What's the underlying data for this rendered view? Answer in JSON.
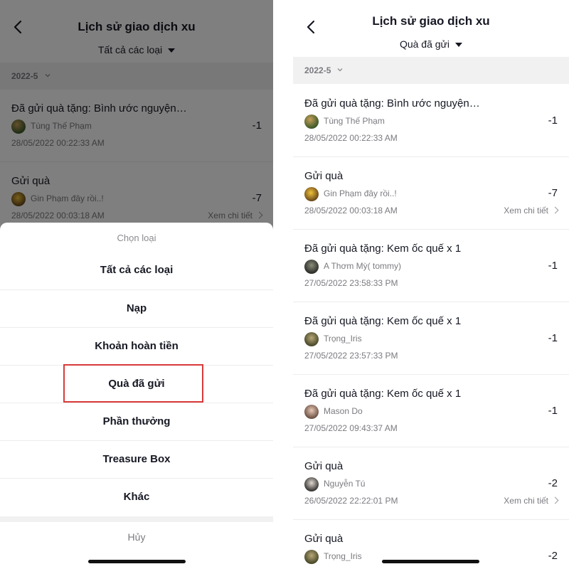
{
  "header": {
    "title": "Lịch sử giao dịch xu"
  },
  "left": {
    "filter_label": "Tất cả các loại",
    "month": "2022-5",
    "items": [
      {
        "title": "Đã gửi quà tặng: Bình ước nguyện…",
        "user": "Tùng Thế Phạm",
        "amount": "-1",
        "time": "28/05/2022 00:22:33 AM"
      },
      {
        "title": "Gửi quà",
        "user": "Gin Phạm đây rồi..!",
        "amount": "-7",
        "time": "28/05/2022 00:03:18 AM",
        "detail": "Xem chi tiết"
      }
    ],
    "sheet": {
      "title": "Chọn loại",
      "options": [
        "Tất cả các loại",
        "Nạp",
        "Khoản hoàn tiền",
        "Quà đã gửi",
        "Phần thưởng",
        "Treasure Box",
        "Khác"
      ],
      "cancel": "Hủy"
    }
  },
  "right": {
    "filter_label": "Quà đã gửi",
    "month": "2022-5",
    "items": [
      {
        "title": "Đã gửi quà tặng: Bình ước nguyện…",
        "user": "Tùng Thế Phạm",
        "amount": "-1",
        "time": "28/05/2022 00:22:33 AM"
      },
      {
        "title": "Gửi quà",
        "user": "Gin Phạm đây rồi..!",
        "amount": "-7",
        "time": "28/05/2022 00:03:18 AM",
        "detail": "Xem chi tiết"
      },
      {
        "title": "Đã gửi quà tặng: Kem ốc quế x 1",
        "user": "A Thơm Mỳ( tommy)",
        "amount": "-1",
        "time": "27/05/2022 23:58:33 PM"
      },
      {
        "title": "Đã gửi quà tặng: Kem ốc quế x 1",
        "user": "Trọng_Iris",
        "amount": "-1",
        "time": "27/05/2022 23:57:33 PM"
      },
      {
        "title": "Đã gửi quà tặng: Kem ốc quế x 1",
        "user": "Mason Do",
        "amount": "-1",
        "time": "27/05/2022 09:43:37 AM"
      },
      {
        "title": "Gửi quà",
        "user": "Nguyễn Tú",
        "amount": "-2",
        "time": "26/05/2022 22:22:01 PM",
        "detail": "Xem chi tiết"
      },
      {
        "title": "Gửi quà",
        "user": "Trọng_Iris",
        "amount": "-2",
        "time": ""
      }
    ]
  },
  "colors": {
    "highlight": "#d93a3a",
    "text_primary": "#161823",
    "text_secondary": "#7a7b80",
    "month_bar": "#f1f1f2"
  },
  "icons": {
    "back": "chevron-left-icon",
    "filter_caret": "caret-down-icon",
    "month_chevron": "chevron-down-icon",
    "detail_chevron": "chevron-right-icon"
  }
}
